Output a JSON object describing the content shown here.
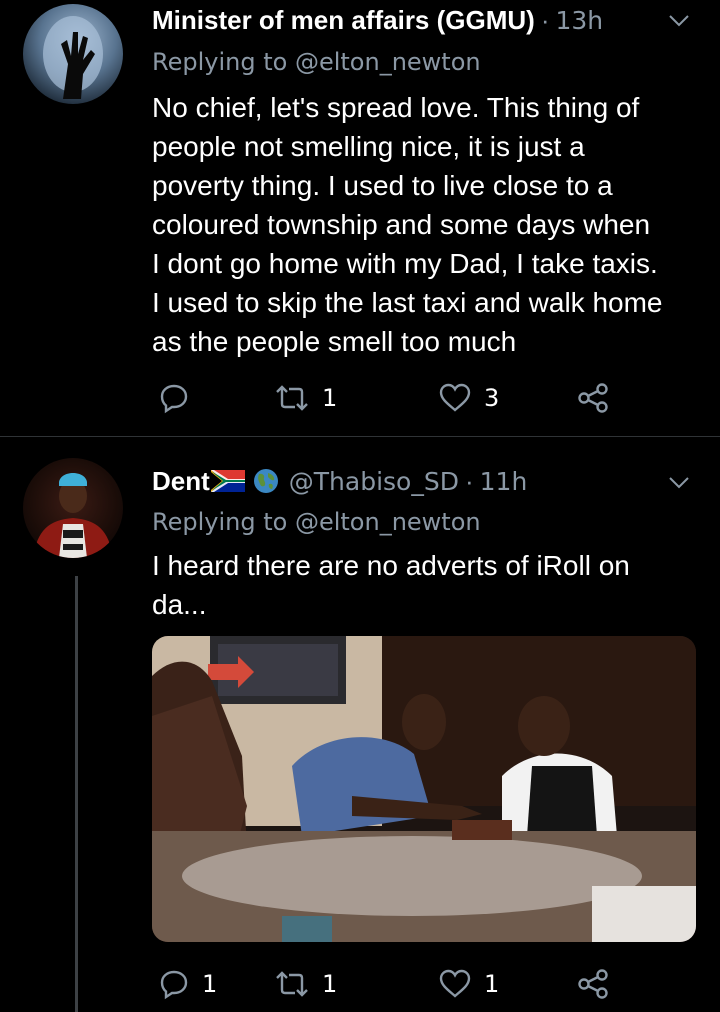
{
  "tweets": [
    {
      "author_name": "Minister of men affairs (GGMU)",
      "handle": "",
      "time": "13h",
      "replying_prefix": "Replying to",
      "replying_to": "@elton_newton",
      "text": "No chief, let's spread love. This thing of\npeople not smelling nice, it is just a\npoverty thing. I used to live close to a\ncoloured township and some days when\nI dont go home with my Dad, I take taxis.\nI used to skip the last taxi and walk home\nas the people smell too much",
      "actions": {
        "reply_count": "",
        "retweet_count": "1",
        "like_count": "3"
      }
    },
    {
      "author_name": "Dent",
      "handle": "@Thabiso_SD",
      "time": "11h",
      "replying_prefix": "Replying to",
      "replying_to": "@elton_newton",
      "text": "I heard there are no adverts of iRoll on\nda...",
      "has_media": true,
      "actions": {
        "reply_count": "1",
        "retweet_count": "1",
        "like_count": "1"
      }
    }
  ],
  "colors": {
    "background": "#000000",
    "secondary_text": "#8b98a5",
    "divider": "#2f3336"
  },
  "icons": [
    "reply-icon",
    "retweet-icon",
    "like-icon",
    "share-icon",
    "chevron-down-icon"
  ]
}
